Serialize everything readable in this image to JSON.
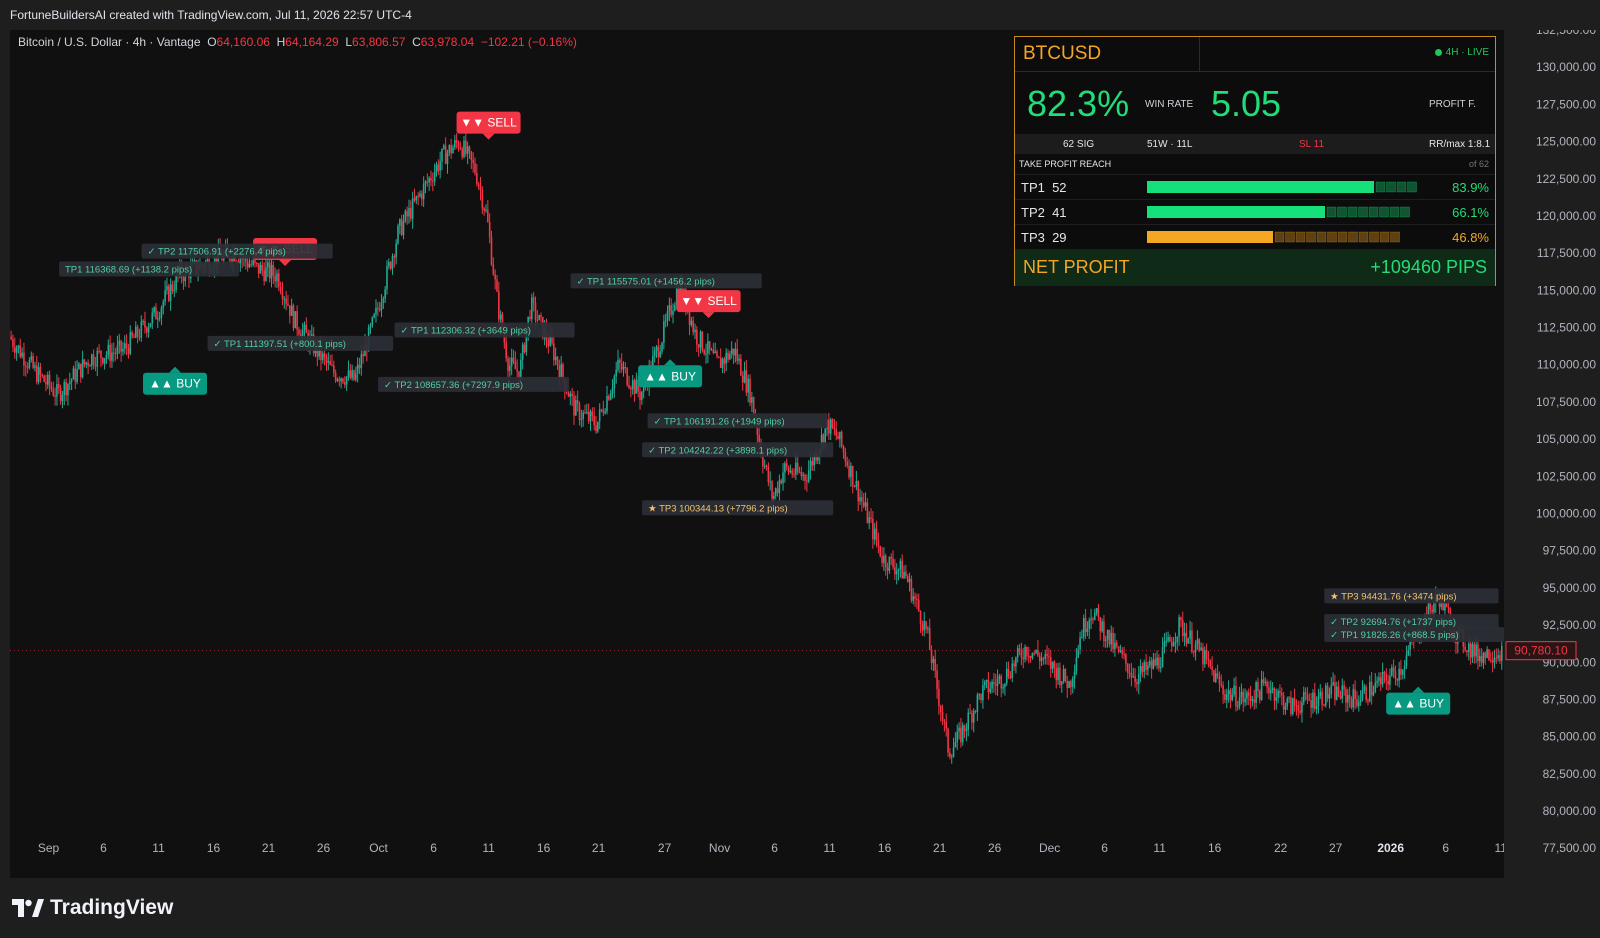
{
  "header": {
    "attribution": "FortuneBuildersAI created with TradingView.com, Jul 11, 2026 22:57 UTC-4"
  },
  "ohlc": {
    "symbol": "Bitcoin / U.S. Dollar · 4h · Vantage",
    "o_label": "O",
    "o": "64,160.06",
    "h_label": "H",
    "h": "64,164.29",
    "l_label": "L",
    "l": "63,806.57",
    "c_label": "C",
    "c": "63,978.04",
    "change": "−102.21 (−0.16%)"
  },
  "colors": {
    "up": "#22ab94",
    "down": "#f23645",
    "buy": "#089981",
    "sell": "#f23645",
    "accent": "#f5a623",
    "green": "#22dd77",
    "bg": "#101010"
  },
  "footer": {
    "logo_text": "TradingView",
    "logo_icon": "tradingview-logo-icon"
  },
  "panel": {
    "symbol": "BTCUSD",
    "live": "4H · LIVE",
    "win_rate": "82.3%",
    "win_rate_label": "WIN RATE",
    "profit_factor": "5.05",
    "profit_factor_label": "PROFIT F.",
    "signals": "62 SIG",
    "wl": "51W · 11L",
    "sl": "SL  11",
    "rr": "RR/max  1:8.1",
    "tp_reach_label": "TAKE PROFIT REACH",
    "of_label": "of 62",
    "tp_rows": [
      {
        "name": "TP1",
        "count": "52",
        "pct": "83.9%",
        "fraction": 0.839,
        "segments": 4,
        "color": "#16e07a"
      },
      {
        "name": "TP2",
        "count": "41",
        "pct": "66.1%",
        "fraction": 0.661,
        "segments": 8,
        "color": "#16e07a"
      },
      {
        "name": "TP3",
        "count": "29",
        "pct": "46.8%",
        "fraction": 0.468,
        "segments": 12,
        "color": "#f5a623"
      }
    ],
    "net_label": "NET PROFIT",
    "net_value": "+109460 PIPS"
  },
  "chart_data": {
    "type": "candlestick",
    "timeframe": "4h",
    "ylim": [
      75500,
      132500
    ],
    "y_ticks": [
      132500,
      130000,
      127500,
      125000,
      122500,
      120000,
      117500,
      115000,
      112500,
      110000,
      107500,
      105000,
      102500,
      100000,
      97500,
      95000,
      92500,
      90000,
      87500,
      85000,
      82500,
      80000,
      77500
    ],
    "y_tick_labels": [
      "132,500.00",
      "130,000.00",
      "127,500.00",
      "125,000.00",
      "122,500.00",
      "120,000.00",
      "117,500.00",
      "115,000.00",
      "112,500.00",
      "110,000.00",
      "107,500.00",
      "105,000.00",
      "102,500.00",
      "100,000.00",
      "97,500.00",
      "95,000.00",
      "92,500.00",
      "90,000.00",
      "87,500.00",
      "85,000.00",
      "82,500.00",
      "80,000.00",
      "77,500.00"
    ],
    "x_tick_labels": [
      "Sep",
      "6",
      "11",
      "16",
      "21",
      "26",
      "Oct",
      "6",
      "11",
      "16",
      "21",
      "27",
      "Nov",
      "6",
      "11",
      "16",
      "21",
      "26",
      "Dec",
      "6",
      "11",
      "16",
      "22",
      "27",
      "2026",
      "6",
      "11"
    ],
    "x_tick_day": [
      1,
      6,
      11,
      16,
      21,
      26,
      31,
      36,
      41,
      46,
      51,
      57,
      62,
      67,
      72,
      77,
      82,
      87,
      92,
      97,
      102,
      107,
      113,
      118,
      123,
      128,
      133
    ],
    "x_range_days": [
      -2.5,
      133.3
    ],
    "price_path": [
      [
        -2.5,
        112000
      ],
      [
        0,
        109500
      ],
      [
        2,
        108000
      ],
      [
        5,
        110500
      ],
      [
        8,
        111000
      ],
      [
        11,
        113500
      ],
      [
        13,
        116000
      ],
      [
        16,
        117000
      ],
      [
        18,
        117600
      ],
      [
        20,
        116500
      ],
      [
        22,
        116000
      ],
      [
        23.5,
        113000
      ],
      [
        25,
        111500
      ],
      [
        27,
        109500
      ],
      [
        29,
        109000
      ],
      [
        31,
        113500
      ],
      [
        33,
        119000
      ],
      [
        35,
        121500
      ],
      [
        37,
        124000
      ],
      [
        38.5,
        125000
      ],
      [
        40,
        123000
      ],
      [
        41,
        120000
      ],
      [
        42,
        114000
      ],
      [
        43,
        110000
      ],
      [
        44,
        109500
      ],
      [
        45,
        114000
      ],
      [
        47,
        111000
      ],
      [
        49,
        107000
      ],
      [
        51,
        106000
      ],
      [
        53,
        110000
      ],
      [
        55,
        108000
      ],
      [
        57,
        112000
      ],
      [
        58.5,
        115500
      ],
      [
        60,
        112000
      ],
      [
        62,
        110000
      ],
      [
        63.5,
        111000
      ],
      [
        65,
        108000
      ],
      [
        66,
        104000
      ],
      [
        67,
        101000
      ],
      [
        68,
        103000
      ],
      [
        70,
        102500
      ],
      [
        72,
        106000
      ],
      [
        73,
        105000
      ],
      [
        75,
        101000
      ],
      [
        77,
        97000
      ],
      [
        79,
        96000
      ],
      [
        81,
        92000
      ],
      [
        82,
        88000
      ],
      [
        83,
        84000
      ],
      [
        84,
        85000
      ],
      [
        86,
        88000
      ],
      [
        88,
        89000
      ],
      [
        90,
        91000
      ],
      [
        92,
        90000
      ],
      [
        94,
        88500
      ],
      [
        95,
        92000
      ],
      [
        96,
        93500
      ],
      [
        98,
        91000
      ],
      [
        100,
        89000
      ],
      [
        102,
        90000
      ],
      [
        104,
        92500
      ],
      [
        106,
        90500
      ],
      [
        108,
        88000
      ],
      [
        110,
        87500
      ],
      [
        112,
        88500
      ],
      [
        114,
        87000
      ],
      [
        116,
        87500
      ],
      [
        118,
        88000
      ],
      [
        120,
        87500
      ],
      [
        122,
        88500
      ],
      [
        124,
        89500
      ],
      [
        126,
        92500
      ],
      [
        127.5,
        94500
      ],
      [
        129,
        92000
      ],
      [
        131,
        90500
      ],
      [
        133.3,
        90780
      ]
    ],
    "last_price": "90,780.10",
    "signals": [
      {
        "type": "BUY",
        "day": 12.5,
        "price": 110000,
        "label": "▲▲ BUY"
      },
      {
        "type": "SELL",
        "day": 22.5,
        "price": 116500,
        "label": "▼▼ SELL"
      },
      {
        "type": "SELL",
        "day": 41,
        "price": 125000,
        "label": "▼▼ SELL"
      },
      {
        "type": "BUY",
        "day": 57.5,
        "price": 110500,
        "label": "▲▲ BUY"
      },
      {
        "type": "SELL",
        "day": 61,
        "price": 113000,
        "label": "▼▼ SELL"
      },
      {
        "type": "BUY",
        "day": 125.5,
        "price": 88500,
        "label": "▲▲ BUY"
      }
    ],
    "tp_labels": [
      {
        "text": "✓ TP2  117506.91  (+2276.4 pips)",
        "day": 10,
        "price": 117600,
        "kind": "tp"
      },
      {
        "text": "TP1  116368.69  (+1138.2 pips)",
        "day": 2.5,
        "price": 116400,
        "kind": "tp"
      },
      {
        "text": "✓ TP1  111397.51  (+800.1 pips)",
        "day": 16,
        "price": 111400,
        "kind": "tp"
      },
      {
        "text": "✓ TP1  112306.32  (+3649 pips)",
        "day": 33,
        "price": 112300,
        "kind": "tp"
      },
      {
        "text": "✓ TP2  108657.36  (+7297.9 pips)",
        "day": 31.5,
        "price": 108650,
        "kind": "tp"
      },
      {
        "text": "✓ TP1  115575.01  (+1456.2 pips)",
        "day": 49,
        "price": 115600,
        "kind": "tp"
      },
      {
        "text": "✓ TP1  106191.26  (+1949 pips)",
        "day": 56,
        "price": 106200,
        "kind": "tp"
      },
      {
        "text": "✓ TP2  104242.22  (+3898.1 pips)",
        "day": 55.5,
        "price": 104250,
        "kind": "tp"
      },
      {
        "text": "★ TP3  100344.13  (+7796.2 pips)",
        "day": 55.5,
        "price": 100350,
        "kind": "tp3"
      },
      {
        "text": "★ TP3  94431.76  (+3474 pips)",
        "day": 117.5,
        "price": 94430,
        "kind": "tp3"
      },
      {
        "text": "✓ TP2  92694.76  (+1737 pips)",
        "day": 117.5,
        "price": 92700,
        "kind": "tp"
      },
      {
        "text": "✓ TP1  91826.26  (+868.5 pips)",
        "day": 117.5,
        "price": 91830,
        "kind": "tp"
      }
    ]
  }
}
